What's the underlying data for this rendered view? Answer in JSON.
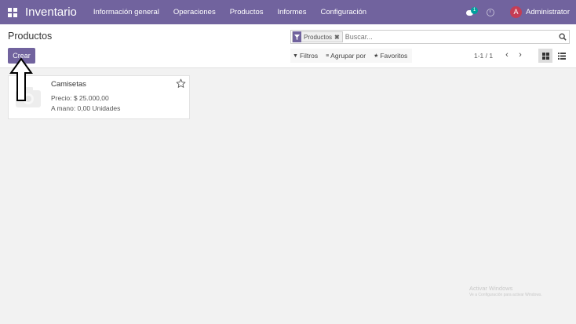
{
  "navbar": {
    "app_name": "Inventario",
    "menu": [
      "Información general",
      "Operaciones",
      "Productos",
      "Informes",
      "Configuración"
    ],
    "chat_badge": "1",
    "user_initial": "A",
    "user_name": "Administrator"
  },
  "control_panel": {
    "breadcrumb": "Productos",
    "create_label": "Crear",
    "search": {
      "facet_label": "Productos",
      "placeholder": "Buscar..."
    },
    "filters": {
      "filters_label": "Filtros",
      "group_by_label": "Agrupar por",
      "favorites_label": "Favoritos"
    },
    "pager": "1-1 / 1"
  },
  "products": [
    {
      "name": "Camisetas",
      "price": "Precio: $ 25.000,00",
      "on_hand": "A mano: 0,00 Unidades"
    }
  ],
  "watermark": {
    "title": "Activar Windows",
    "subtitle": "Ve a Configuración para activar Windows."
  },
  "colors": {
    "primary": "#71639e",
    "avatar": "#c53d54",
    "badge": "#00a09d"
  }
}
